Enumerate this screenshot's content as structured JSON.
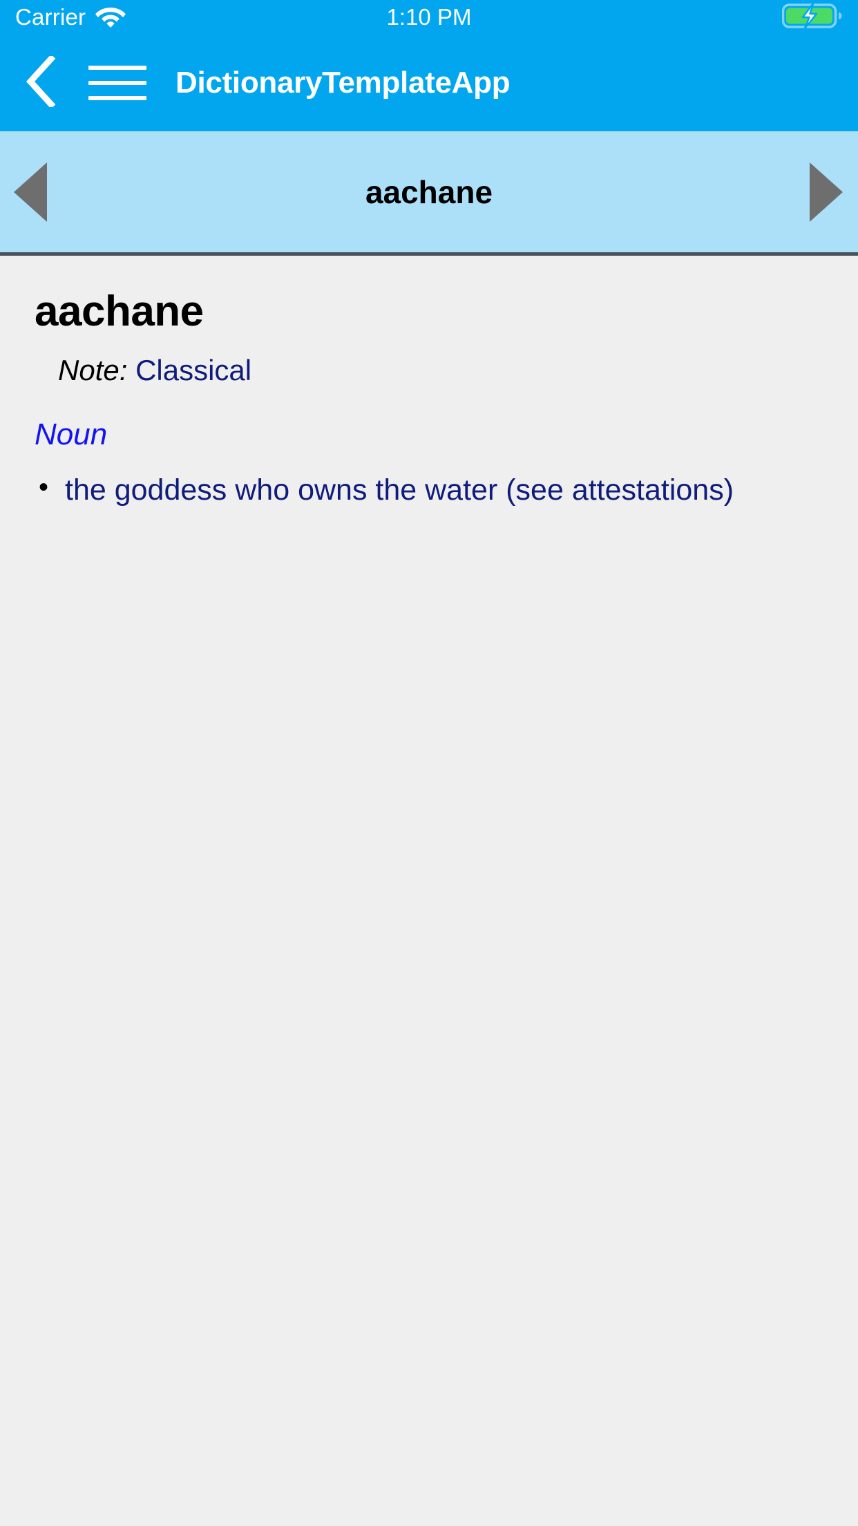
{
  "status_bar": {
    "carrier": "Carrier",
    "wifi_icon": "wifi-icon",
    "time": "1:10 PM",
    "battery_icon": "battery-charging-icon",
    "background_color": "#02a6ef",
    "text_color": "#ffffff",
    "battery_fill_color": "#4cd964"
  },
  "nav_header": {
    "back_icon": "chevron-left-icon",
    "menu_icon": "hamburger-menu-icon",
    "title": "DictionaryTemplateApp",
    "background_color": "#02a6ef"
  },
  "word_nav": {
    "prev_icon": "triangle-left-icon",
    "next_icon": "triangle-right-icon",
    "current_word": "aachane",
    "background_color": "#ace0f9",
    "arrow_color": "#6e6e6e",
    "separator_color": "#4b5159"
  },
  "entry": {
    "headword": "aachane",
    "note_label": "Note:",
    "note_value": "Classical",
    "part_of_speech": "Noun",
    "senses": [
      {
        "bullet": "•",
        "text": "the goddess who owns the water (see attestations)"
      }
    ],
    "background_color": "#efefef",
    "definition_color": "#101c7a",
    "pos_color": "#1414f0"
  }
}
